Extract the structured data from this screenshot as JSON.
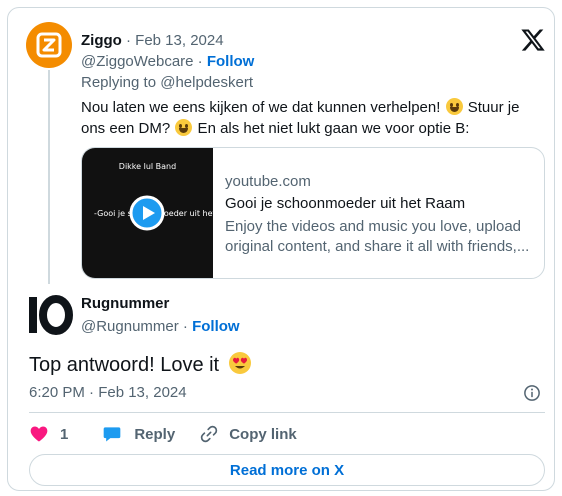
{
  "colors": {
    "link": "#006fd6",
    "muted": "#536471",
    "ziggo_orange": "#f48c00",
    "like": "#f91880",
    "border": "#cfd9de"
  },
  "parent": {
    "name": "Ziggo",
    "separator": " · ",
    "date": "Feb 13, 2024",
    "handle": "@ZiggoWebcare",
    "follow": "Follow",
    "replying_prefix": "Replying to ",
    "replying_to": "@helpdeskert",
    "text_part1": "Nou laten we eens kijken of we dat kunnen verhelpen! ",
    "text_part2": " Stuur je ons een DM? ",
    "text_part3": " En als het niet lukt gaan we voor optie B:",
    "link_card": {
      "thumb_title": "Dikke lul Band",
      "thumb_text": "-Gooi je schoonmoeder uit het",
      "domain": "youtube.com",
      "title": "Gooi je schoonmoeder uit het Raam",
      "description": "Enjoy the videos and music you love, upload original content, and share it all with friends,..."
    }
  },
  "tweet": {
    "name": "Rugnummer",
    "handle": "@Rugnummer",
    "follow": "Follow",
    "avatar_text": "10",
    "text": "Top antwoord! Love it",
    "timestamp": "6:20 PM · Feb 13, 2024"
  },
  "actions": {
    "like_count": "1",
    "reply": "Reply",
    "copy_link": "Copy link"
  },
  "read_more": "Read more on X",
  "icons": [
    "x-logo-icon",
    "ziggo-logo-icon",
    "play-icon",
    "info-icon",
    "heart-icon",
    "reply-bubble-icon",
    "link-icon",
    "heart-eyes-emoji",
    "grinning-emoji"
  ]
}
